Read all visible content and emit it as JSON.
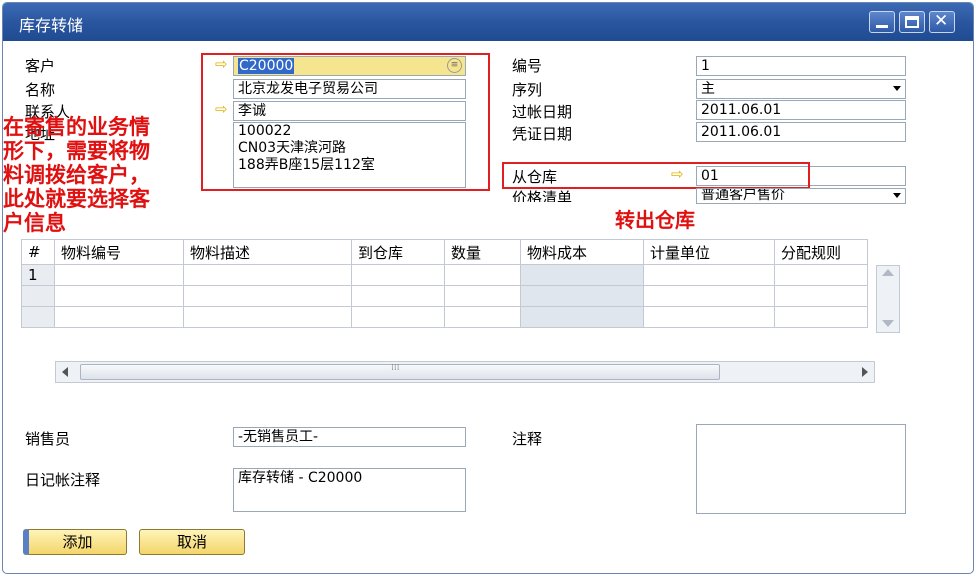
{
  "window": {
    "title": "库存转储"
  },
  "left_form": {
    "customer_label": "客户",
    "customer_value": "C20000",
    "name_label": "名称",
    "name_value": "北京龙发电子贸易公司",
    "contact_label": "联系人",
    "contact_value": "李诚",
    "address_label": "地址",
    "address_value": "100022\nCN03天津滨河路\n188弄B座15层112室"
  },
  "right_form": {
    "number_label": "编号",
    "number_value": "1",
    "series_label": "序列",
    "series_value": "主",
    "posting_date_label": "过帐日期",
    "posting_date_value": "2011.06.01",
    "doc_date_label": "凭证日期",
    "doc_date_value": "2011.06.01",
    "from_wh_label": "从仓库",
    "from_wh_value": "01",
    "price_list_label": "价格清单",
    "price_list_value": "普通客户售价"
  },
  "annotations": {
    "customer_note": "在寄售的业务情\n形下，需要将物\n料调拨给客户，\n此处就要选择客\n户信息",
    "warehouse_note": "转出仓库"
  },
  "table": {
    "headers": [
      "#",
      "物料编号",
      "物料描述",
      "到仓库",
      "数量",
      "物料成本",
      "计量单位",
      "分配规则"
    ],
    "rows": [
      [
        "1",
        "",
        "",
        "",
        "",
        "",
        "",
        ""
      ],
      [
        "",
        "",
        "",
        "",
        "",
        "",
        "",
        ""
      ],
      [
        "",
        "",
        "",
        "",
        "",
        "",
        "",
        ""
      ]
    ]
  },
  "bottom": {
    "sales_label": "销售员",
    "sales_value": "-无销售员工-",
    "journal_label": "日记帐注释",
    "journal_value": "库存转储 - C20000",
    "remarks_label": "注释",
    "remarks_value": ""
  },
  "buttons": {
    "add": "添加",
    "cancel": "取消"
  },
  "colors": {
    "title_bar": "#2a569f",
    "annotation": "#e01010",
    "button": "#f3d56a",
    "focus": "#f6e58f"
  }
}
